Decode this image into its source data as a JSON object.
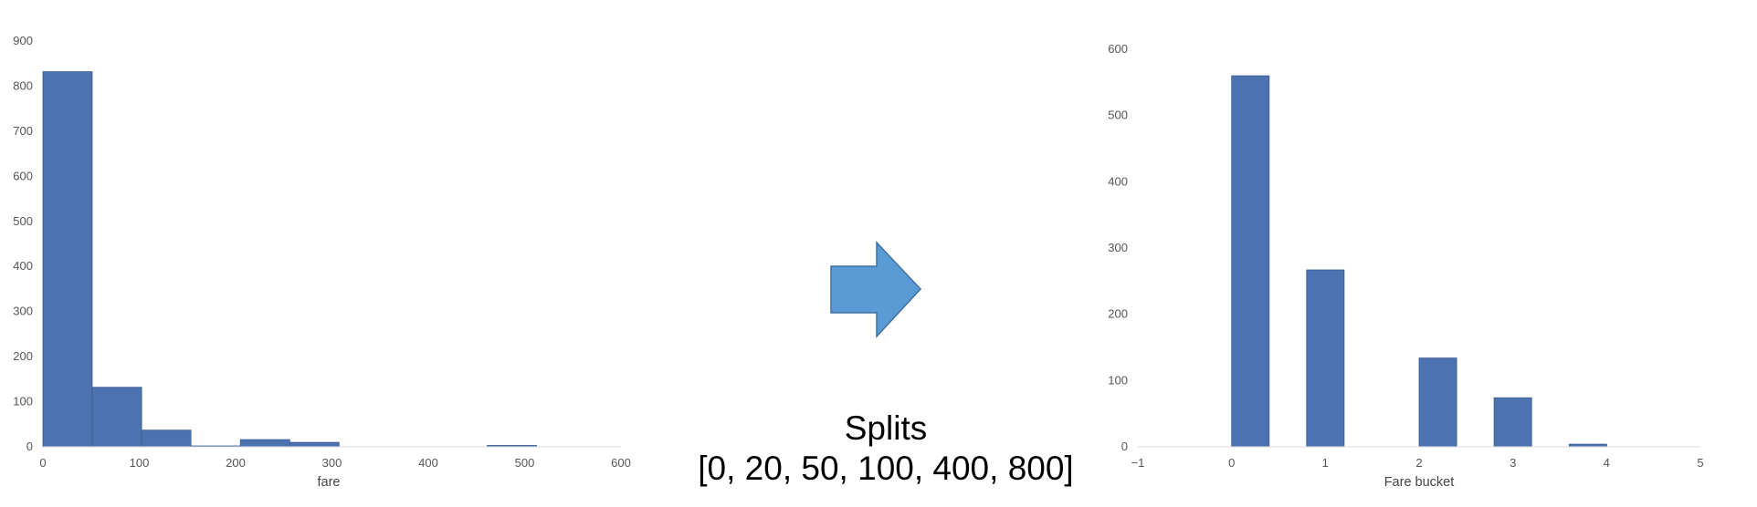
{
  "chart_data": [
    {
      "type": "bar",
      "subtype": "histogram",
      "title": "",
      "xlabel": "fare",
      "ylabel": "",
      "xlim": [
        0,
        600
      ],
      "ylim": [
        0,
        900
      ],
      "xticks": [
        0,
        100,
        200,
        300,
        400,
        500,
        600
      ],
      "yticks": [
        0,
        100,
        200,
        300,
        400,
        500,
        600,
        700,
        800,
        900
      ],
      "bins": [
        {
          "x0": 0,
          "x1": 51.2,
          "value": 832
        },
        {
          "x0": 51.2,
          "x1": 102.5,
          "value": 132
        },
        {
          "x0": 102.5,
          "x1": 153.7,
          "value": 37
        },
        {
          "x0": 153.7,
          "x1": 204.9,
          "value": 2
        },
        {
          "x0": 204.9,
          "x1": 256.2,
          "value": 16
        },
        {
          "x0": 256.2,
          "x1": 307.4,
          "value": 10
        },
        {
          "x0": 307.4,
          "x1": 358.7,
          "value": 0
        },
        {
          "x0": 358.7,
          "x1": 409.9,
          "value": 0
        },
        {
          "x0": 409.9,
          "x1": 461.1,
          "value": 0
        },
        {
          "x0": 461.1,
          "x1": 512.3,
          "value": 3
        }
      ],
      "grid": false,
      "color": "#4c72b0"
    },
    {
      "type": "bar",
      "subtype": "histogram",
      "title": "",
      "xlabel": "Fare bucket",
      "ylabel": "",
      "xlim": [
        -1,
        5
      ],
      "ylim": [
        0,
        600
      ],
      "xticks": [
        -1,
        0,
        1,
        2,
        3,
        4,
        5
      ],
      "xtick_labels": [
        "−1",
        "0",
        "1",
        "2",
        "3",
        "4",
        "5"
      ],
      "yticks": [
        0,
        100,
        200,
        300,
        400,
        500,
        600
      ],
      "bins": [
        {
          "x0": 0.0,
          "x1": 0.4,
          "value": 560
        },
        {
          "x0": 0.8,
          "x1": 1.2,
          "value": 267
        },
        {
          "x0": 1.2,
          "x1": 1.6,
          "value": 0
        },
        {
          "x0": 1.6,
          "x1": 2.0,
          "value": 0
        },
        {
          "x0": 2.0,
          "x1": 2.4,
          "value": 134
        },
        {
          "x0": 2.4,
          "x1": 2.8,
          "value": 0
        },
        {
          "x0": 2.8,
          "x1": 3.2,
          "value": 74
        },
        {
          "x0": 3.2,
          "x1": 3.6,
          "value": 0
        },
        {
          "x0": 3.6,
          "x1": 4.0,
          "value": 4
        }
      ],
      "grid": false,
      "color": "#4c72b0"
    }
  ],
  "arrow": {
    "icon": "right-arrow-icon",
    "fill": "#5b9bd5",
    "stroke": "#41719c"
  },
  "caption": {
    "line1": "Splits",
    "line2": "[0, 20, 50, 100, 400, 800]"
  }
}
